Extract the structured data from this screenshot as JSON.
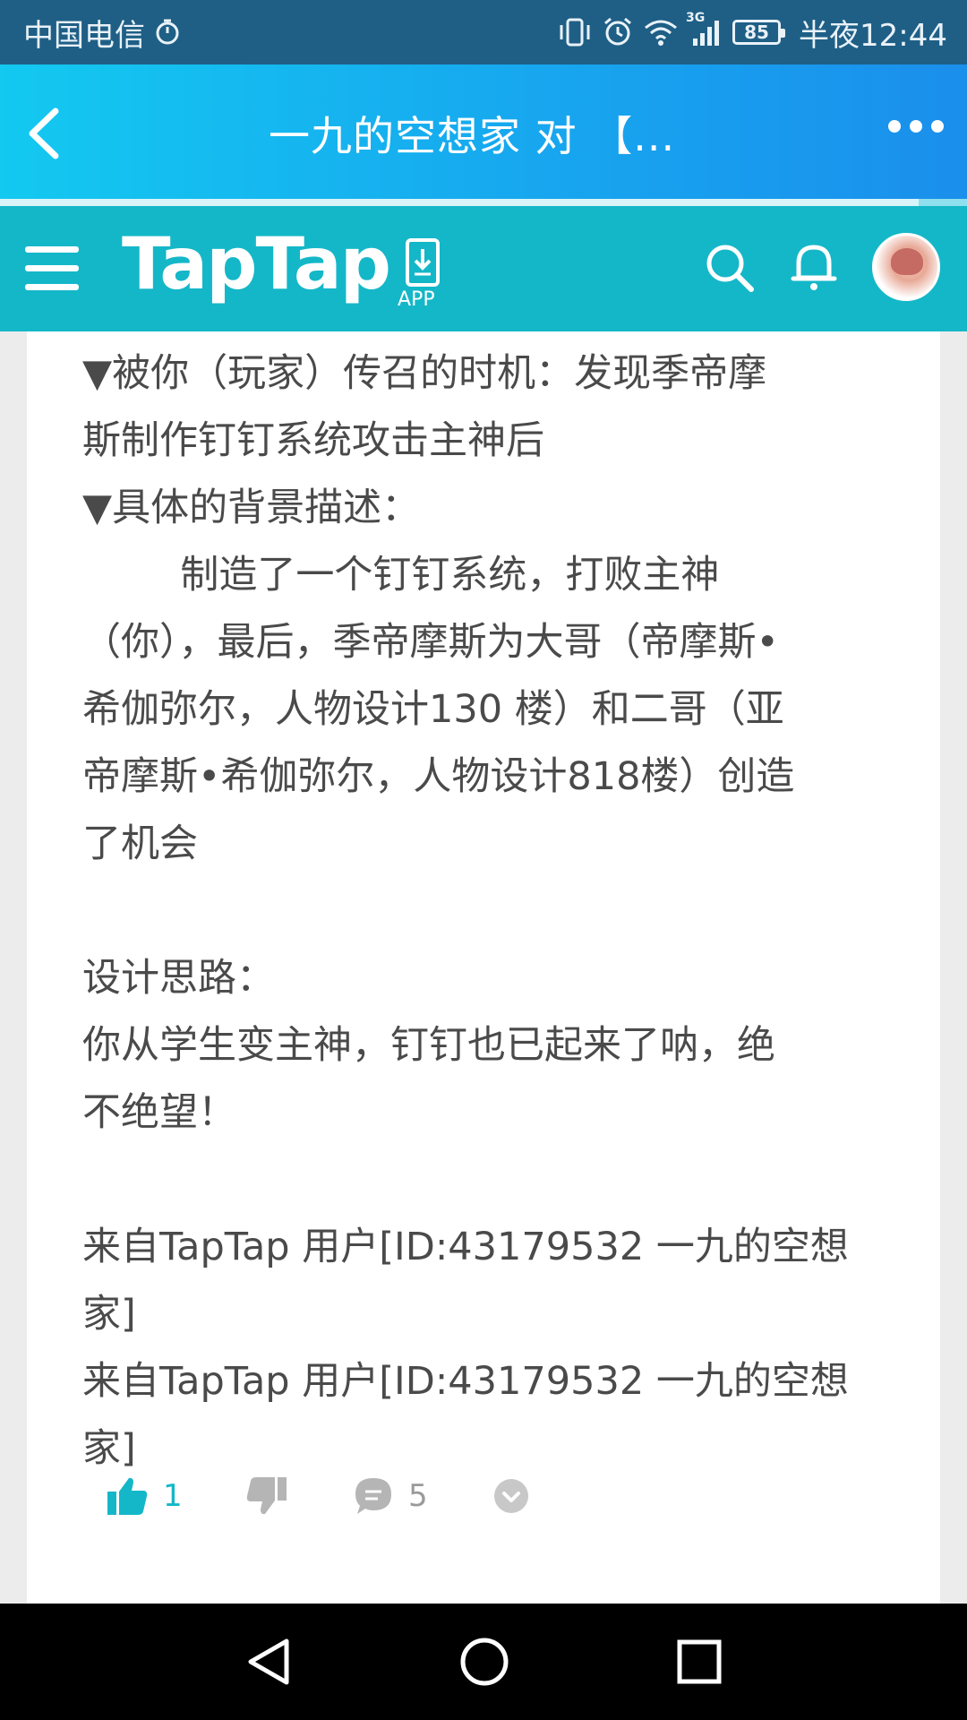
{
  "status_bar": {
    "carrier": "中国电信",
    "signal_label": "3G",
    "battery": "85",
    "time": "半夜12:44"
  },
  "titlebar": {
    "title": "一九的空想家 对 【..."
  },
  "taptap": {
    "logo": "TapTap",
    "app_label": "APP"
  },
  "post": {
    "text": "▼被你（玩家）传召的时机：发现季帝摩\n斯制作钉钉系统攻击主神后\n▼具体的背景描述：\n        制造了一个钉钉系统，打败主神\n（你），最后，季帝摩斯为大哥（帝摩斯•\n希伽弥尔，人物设计130 楼）和二哥（亚\n帝摩斯•希伽弥尔，人物设计818楼）创造\n了机会\n\n设计思路：\n你从学生变主神，钉钉也已起来了呐，绝\n不绝望！\n\n来自TapTap 用户[ID:43179532 一九的空想\n家]\n来自TapTap 用户[ID:43179532 一九的空想\n家]"
  },
  "actions": {
    "like_count": "1",
    "comment_count": "5"
  },
  "colors": {
    "accent": "#14b7c8",
    "title_gradient_start": "#13c9f0",
    "title_gradient_end": "#1a8fec"
  }
}
